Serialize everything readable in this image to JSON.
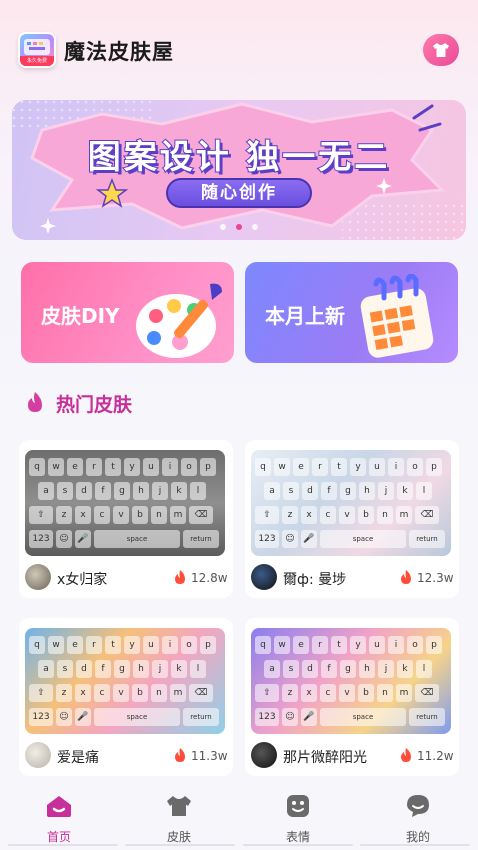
{
  "header": {
    "title": "魔法皮肤屋",
    "logo_caption": "永久免费"
  },
  "banner": {
    "title": "图案设计 独一无二",
    "pill": "随心创作",
    "pages": 3,
    "active_page": 2
  },
  "promos": [
    {
      "label": "皮肤DIY"
    },
    {
      "label": "本月上新"
    }
  ],
  "section": {
    "title": "热门皮肤"
  },
  "keyboard": {
    "row1": [
      "q",
      "w",
      "e",
      "r",
      "t",
      "y",
      "u",
      "i",
      "o",
      "p"
    ],
    "row2": [
      "a",
      "s",
      "d",
      "f",
      "g",
      "h",
      "j",
      "k",
      "l"
    ],
    "row3": [
      "z",
      "x",
      "c",
      "v",
      "b",
      "n",
      "m"
    ],
    "num": "123",
    "space": "space",
    "return": "return"
  },
  "skins": [
    {
      "author": "x女归家",
      "count": "12.8w"
    },
    {
      "author": "爾ф:  曼埗",
      "count": "12.3w"
    },
    {
      "author": "爱是痛",
      "count": "11.3w"
    },
    {
      "author": "那片微醉阳光",
      "count": "11.2w"
    }
  ],
  "tabs": [
    {
      "label": "首页",
      "icon": "home-icon",
      "active": true
    },
    {
      "label": "皮肤",
      "icon": "shirt-icon",
      "active": false
    },
    {
      "label": "表情",
      "icon": "emoji-icon",
      "active": false
    },
    {
      "label": "我的",
      "icon": "profile-icon",
      "active": false
    }
  ],
  "colors": {
    "accent": "#c72f9a",
    "flame": "#ff4d3a"
  }
}
